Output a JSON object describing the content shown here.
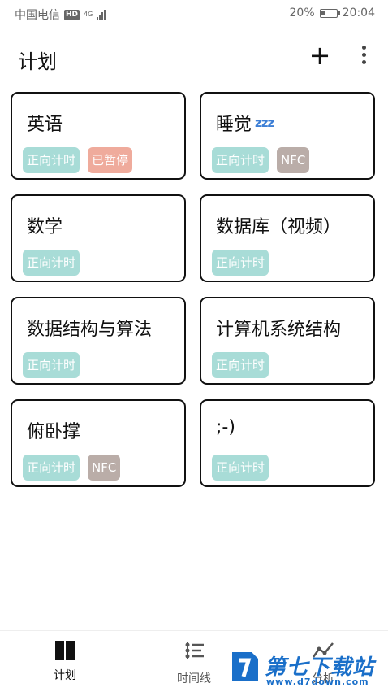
{
  "status_bar": {
    "carrier": "中国电信",
    "hd": "HD",
    "network": "4G",
    "battery": "20%",
    "time": "20:04"
  },
  "header": {
    "title": "计划",
    "add_label": "+"
  },
  "cards": [
    {
      "name": "英语",
      "tags": [
        "正向计时",
        "已暂停"
      ]
    },
    {
      "name": "睡觉",
      "emoji": "zᴢz",
      "tags": [
        "正向计时",
        "NFC"
      ]
    },
    {
      "name": "数学",
      "tags": [
        "正向计时"
      ]
    },
    {
      "name": "数据库（视频）",
      "tags": [
        "正向计时"
      ]
    },
    {
      "name": "数据结构与算法",
      "tags": [
        "正向计时"
      ]
    },
    {
      "name": "计算机系统结构",
      "tags": [
        "正向计时"
      ]
    },
    {
      "name": "俯卧撑",
      "tags": [
        "正向计时",
        "NFC"
      ]
    },
    {
      "name": ";-)",
      "tags": [
        "正向计时"
      ]
    }
  ],
  "bottom_nav": [
    {
      "label": "计划",
      "icon": "dashboard-icon",
      "active": true
    },
    {
      "label": "时间线",
      "icon": "timeline-icon",
      "active": false
    },
    {
      "label": "分析",
      "icon": "chart-icon",
      "active": false
    }
  ],
  "watermark": {
    "name": "第七下载站",
    "url": "www.d7down.com"
  },
  "colors": {
    "tag_forward": "#a8dcd7",
    "tag_paused": "#efab9c",
    "tag_nfc": "#baada8"
  }
}
